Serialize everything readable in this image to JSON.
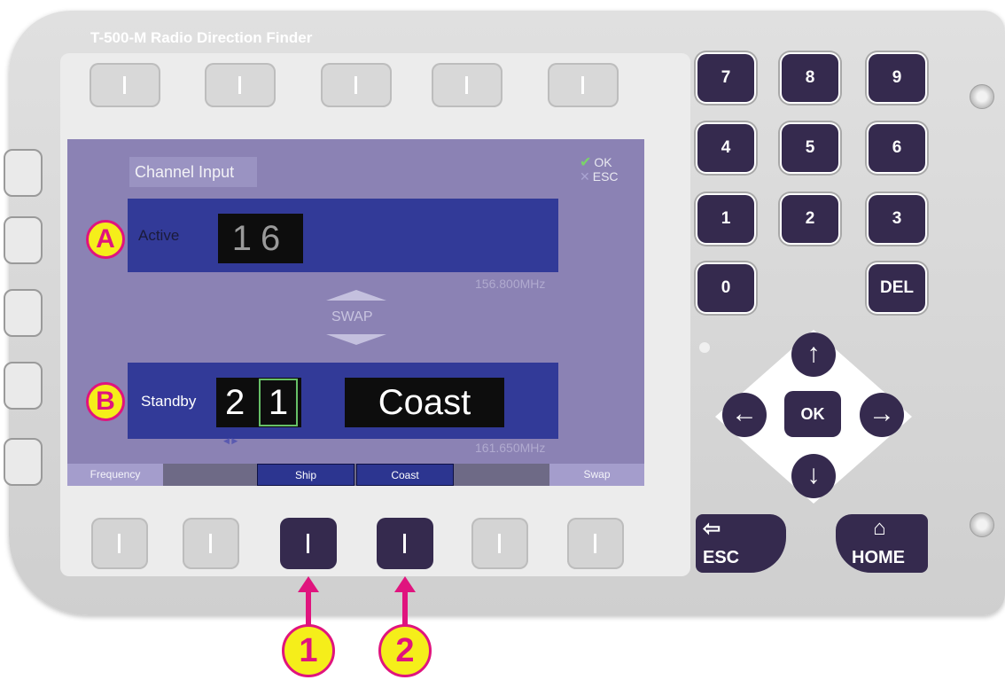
{
  "device": {
    "title": "T-500-M Radio Direction Finder"
  },
  "screen": {
    "title": "Channel Input",
    "hints": {
      "ok": "OK",
      "esc": "ESC"
    },
    "active": {
      "label": "Active",
      "channel": "16",
      "frequency": "156.800MHz"
    },
    "swap_label": "SWAP",
    "standby": {
      "label": "Standby",
      "digit1": "2",
      "digit2": "1",
      "mode": "Coast",
      "frequency": "161.650MHz"
    },
    "softkeys": {
      "frequency": "Frequency",
      "ship": "Ship",
      "coast": "Coast",
      "swap": "Swap"
    }
  },
  "keypad": {
    "keys": [
      "7",
      "8",
      "9",
      "4",
      "5",
      "6",
      "1",
      "2",
      "3",
      "0",
      "DEL"
    ],
    "ok": "OK",
    "esc": "ESC",
    "home": "HOME"
  },
  "callouts": {
    "a": "A",
    "b": "B",
    "one": "1",
    "two": "2"
  },
  "colors": {
    "screen_bg": "#8b82b4",
    "panel": "#323a98",
    "key": "#352a4e",
    "callout_fill": "#f5ee1a",
    "callout_stroke": "#e0147e",
    "selection": "#67c067"
  }
}
